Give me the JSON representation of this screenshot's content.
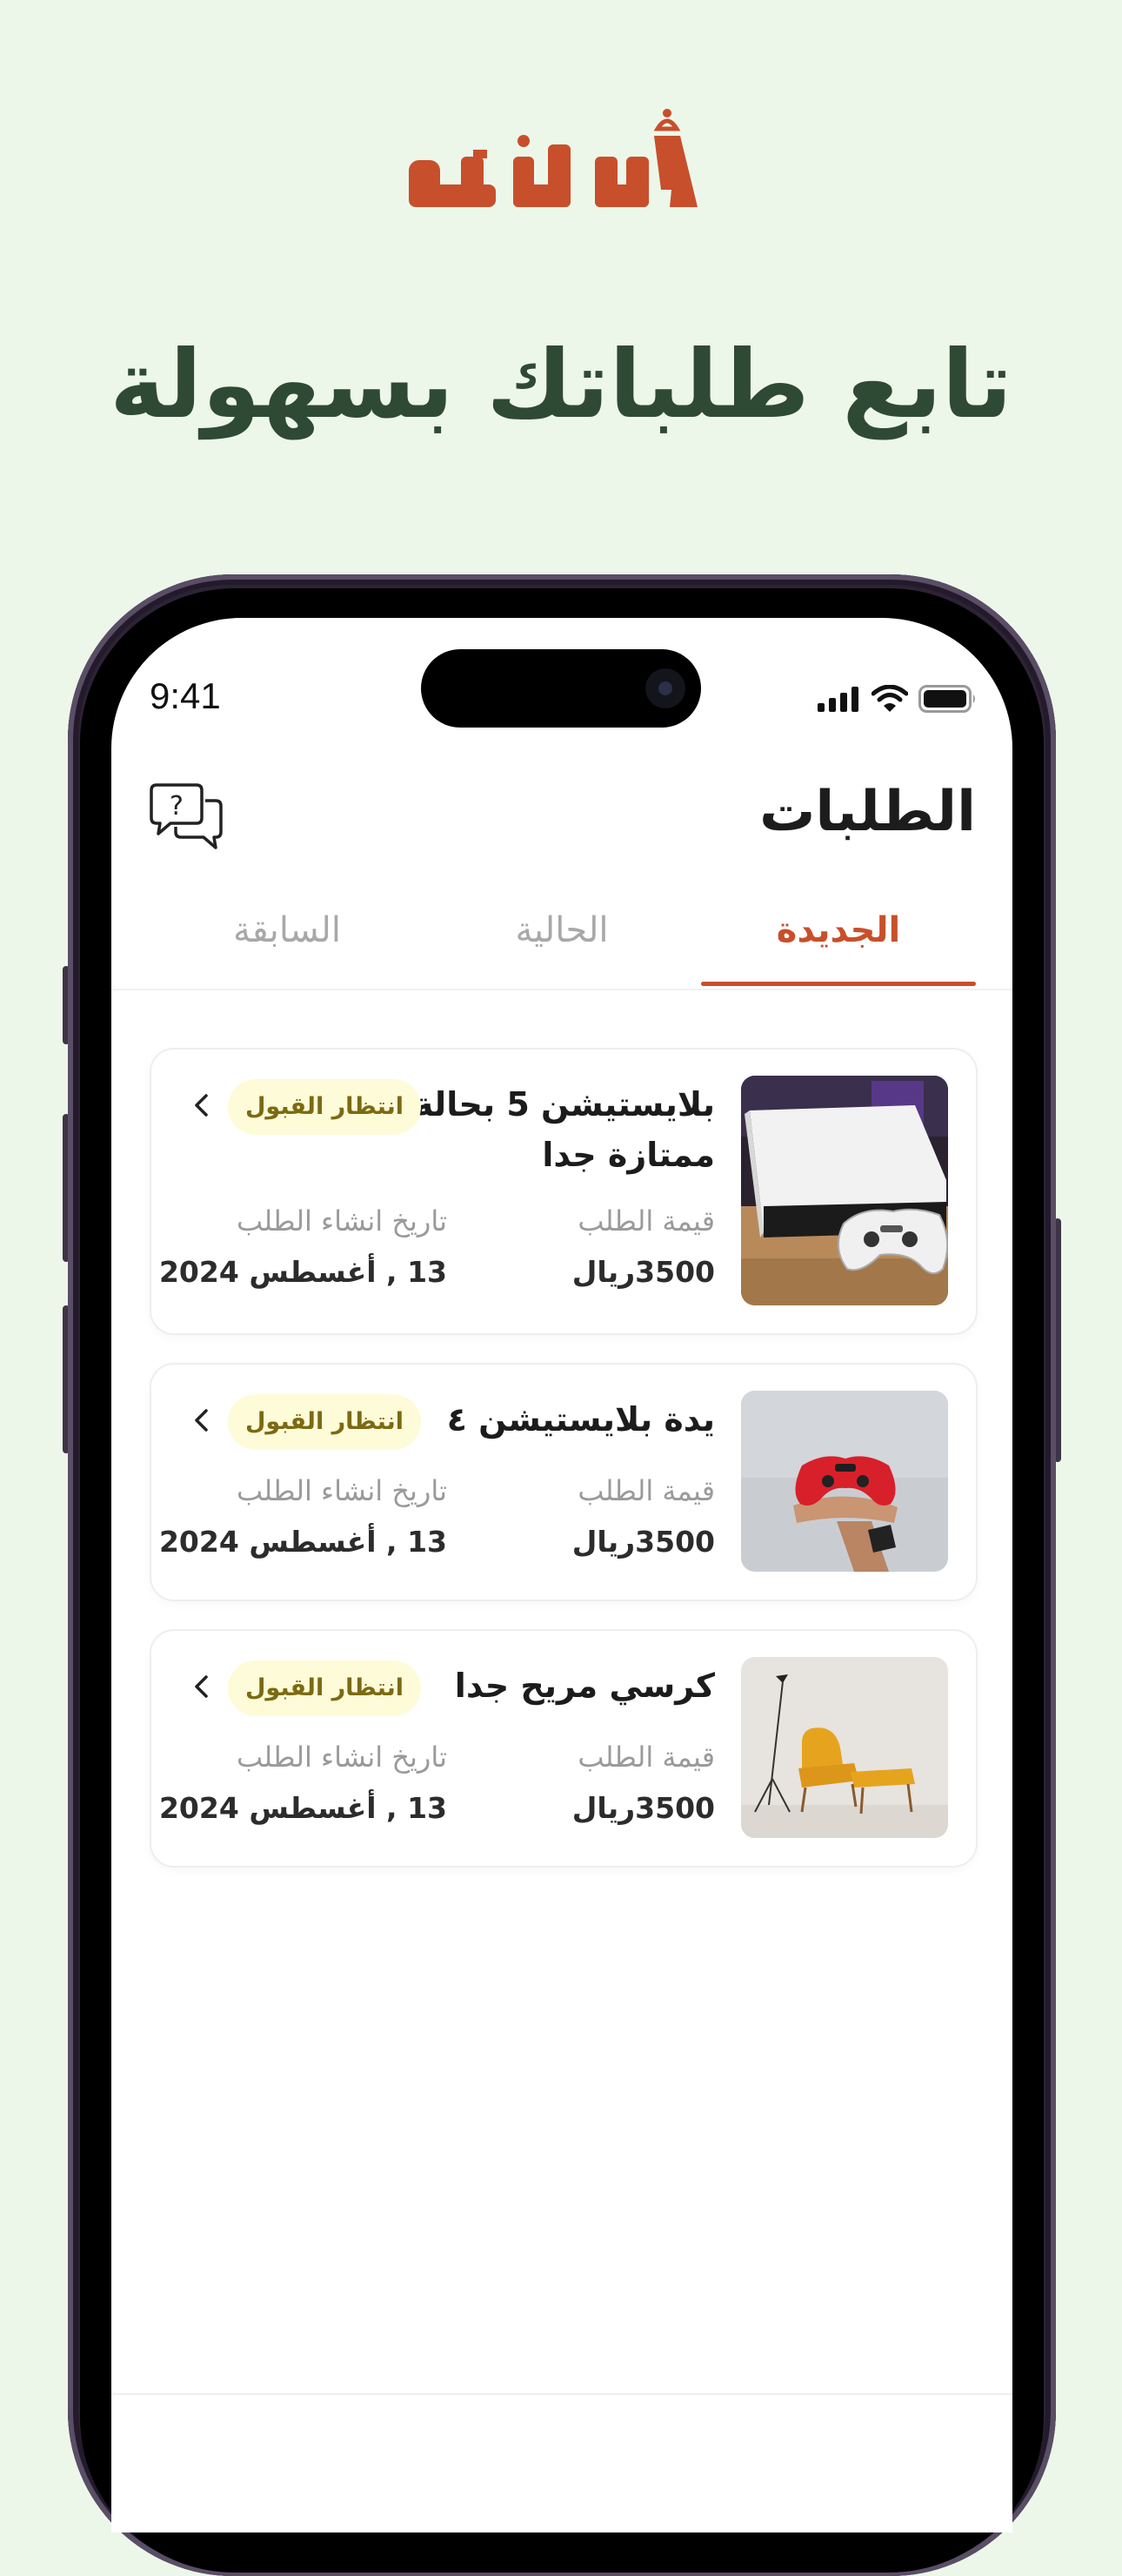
{
  "brand": {
    "name": "أجرنيه",
    "color": "#c84f2b"
  },
  "headline": "تابع طلباتك بسهولة",
  "status_bar": {
    "time": "9:41"
  },
  "header": {
    "title": "الطلبات"
  },
  "tabs": [
    {
      "label": "الجديدة",
      "active": true
    },
    {
      "label": "الحالية",
      "active": false
    },
    {
      "label": "السابقة",
      "active": false
    }
  ],
  "orders": [
    {
      "title": "بلايستيشن 5 بحالة ممتازة جدا",
      "status": "انتظار القبول",
      "price_label": "قيمة الطلب",
      "price": "3500ريال",
      "date_label": "تاريخ انشاء الطلب",
      "date": "13 , أغسطس 2024",
      "image": "playstation-console-photo"
    },
    {
      "title": "يدة بلايستيشن ٤",
      "status": "انتظار القبول",
      "price_label": "قيمة الطلب",
      "price": "3500ريال",
      "date_label": "تاريخ انشاء الطلب",
      "date": "13 , أغسطس 2024",
      "image": "red-controller-photo"
    },
    {
      "title": "كرسي مريح جدا",
      "status": "انتظار القبول",
      "price_label": "قيمة الطلب",
      "price": "3500ريال",
      "date_label": "تاريخ انشاء الطلب",
      "date": "13 , أغسطس 2024",
      "image": "yellow-armchair-photo"
    }
  ]
}
